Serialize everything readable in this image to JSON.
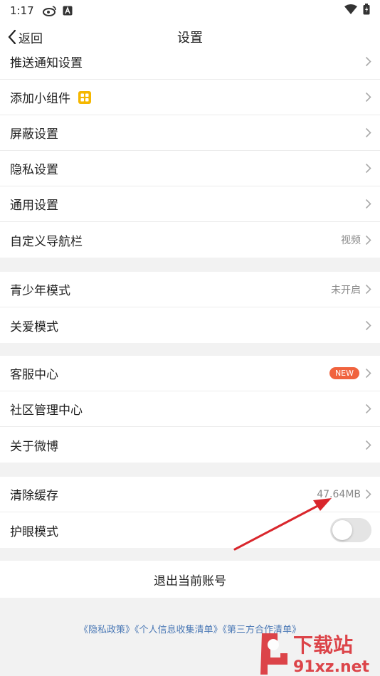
{
  "status_bar": {
    "time": "1:17"
  },
  "nav": {
    "back_label": "返回",
    "title": "设置"
  },
  "group1": [
    {
      "label": "推送通知设置",
      "value": ""
    },
    {
      "label": "添加小组件",
      "value": ""
    },
    {
      "label": "屏蔽设置",
      "value": ""
    },
    {
      "label": "隐私设置",
      "value": ""
    },
    {
      "label": "通用设置",
      "value": ""
    },
    {
      "label": "自定义导航栏",
      "value": "视频"
    }
  ],
  "group2": [
    {
      "label": "青少年模式",
      "value": "未开启"
    },
    {
      "label": "关爱模式",
      "value": ""
    }
  ],
  "group3": [
    {
      "label": "客服中心",
      "badge": "NEW"
    },
    {
      "label": "社区管理中心"
    },
    {
      "label": "关于微博"
    }
  ],
  "group4": [
    {
      "label": "清除缓存",
      "value": "47.64MB"
    },
    {
      "label": "护眼模式",
      "toggle": false
    }
  ],
  "logout_label": "退出当前账号",
  "footer": {
    "privacy_policy": "《隐私政策》",
    "personal_info": "《个人信息收集清单》",
    "third_party": "《第三方合作清单》"
  },
  "colors": {
    "accent_badge": "#f0633e",
    "link": "#4a78b5",
    "widget_icon": "#f5b700",
    "annotation_arrow": "#d9262c"
  },
  "watermark": {
    "text_top": "下载站",
    "text_bottom": "91xz.net"
  }
}
